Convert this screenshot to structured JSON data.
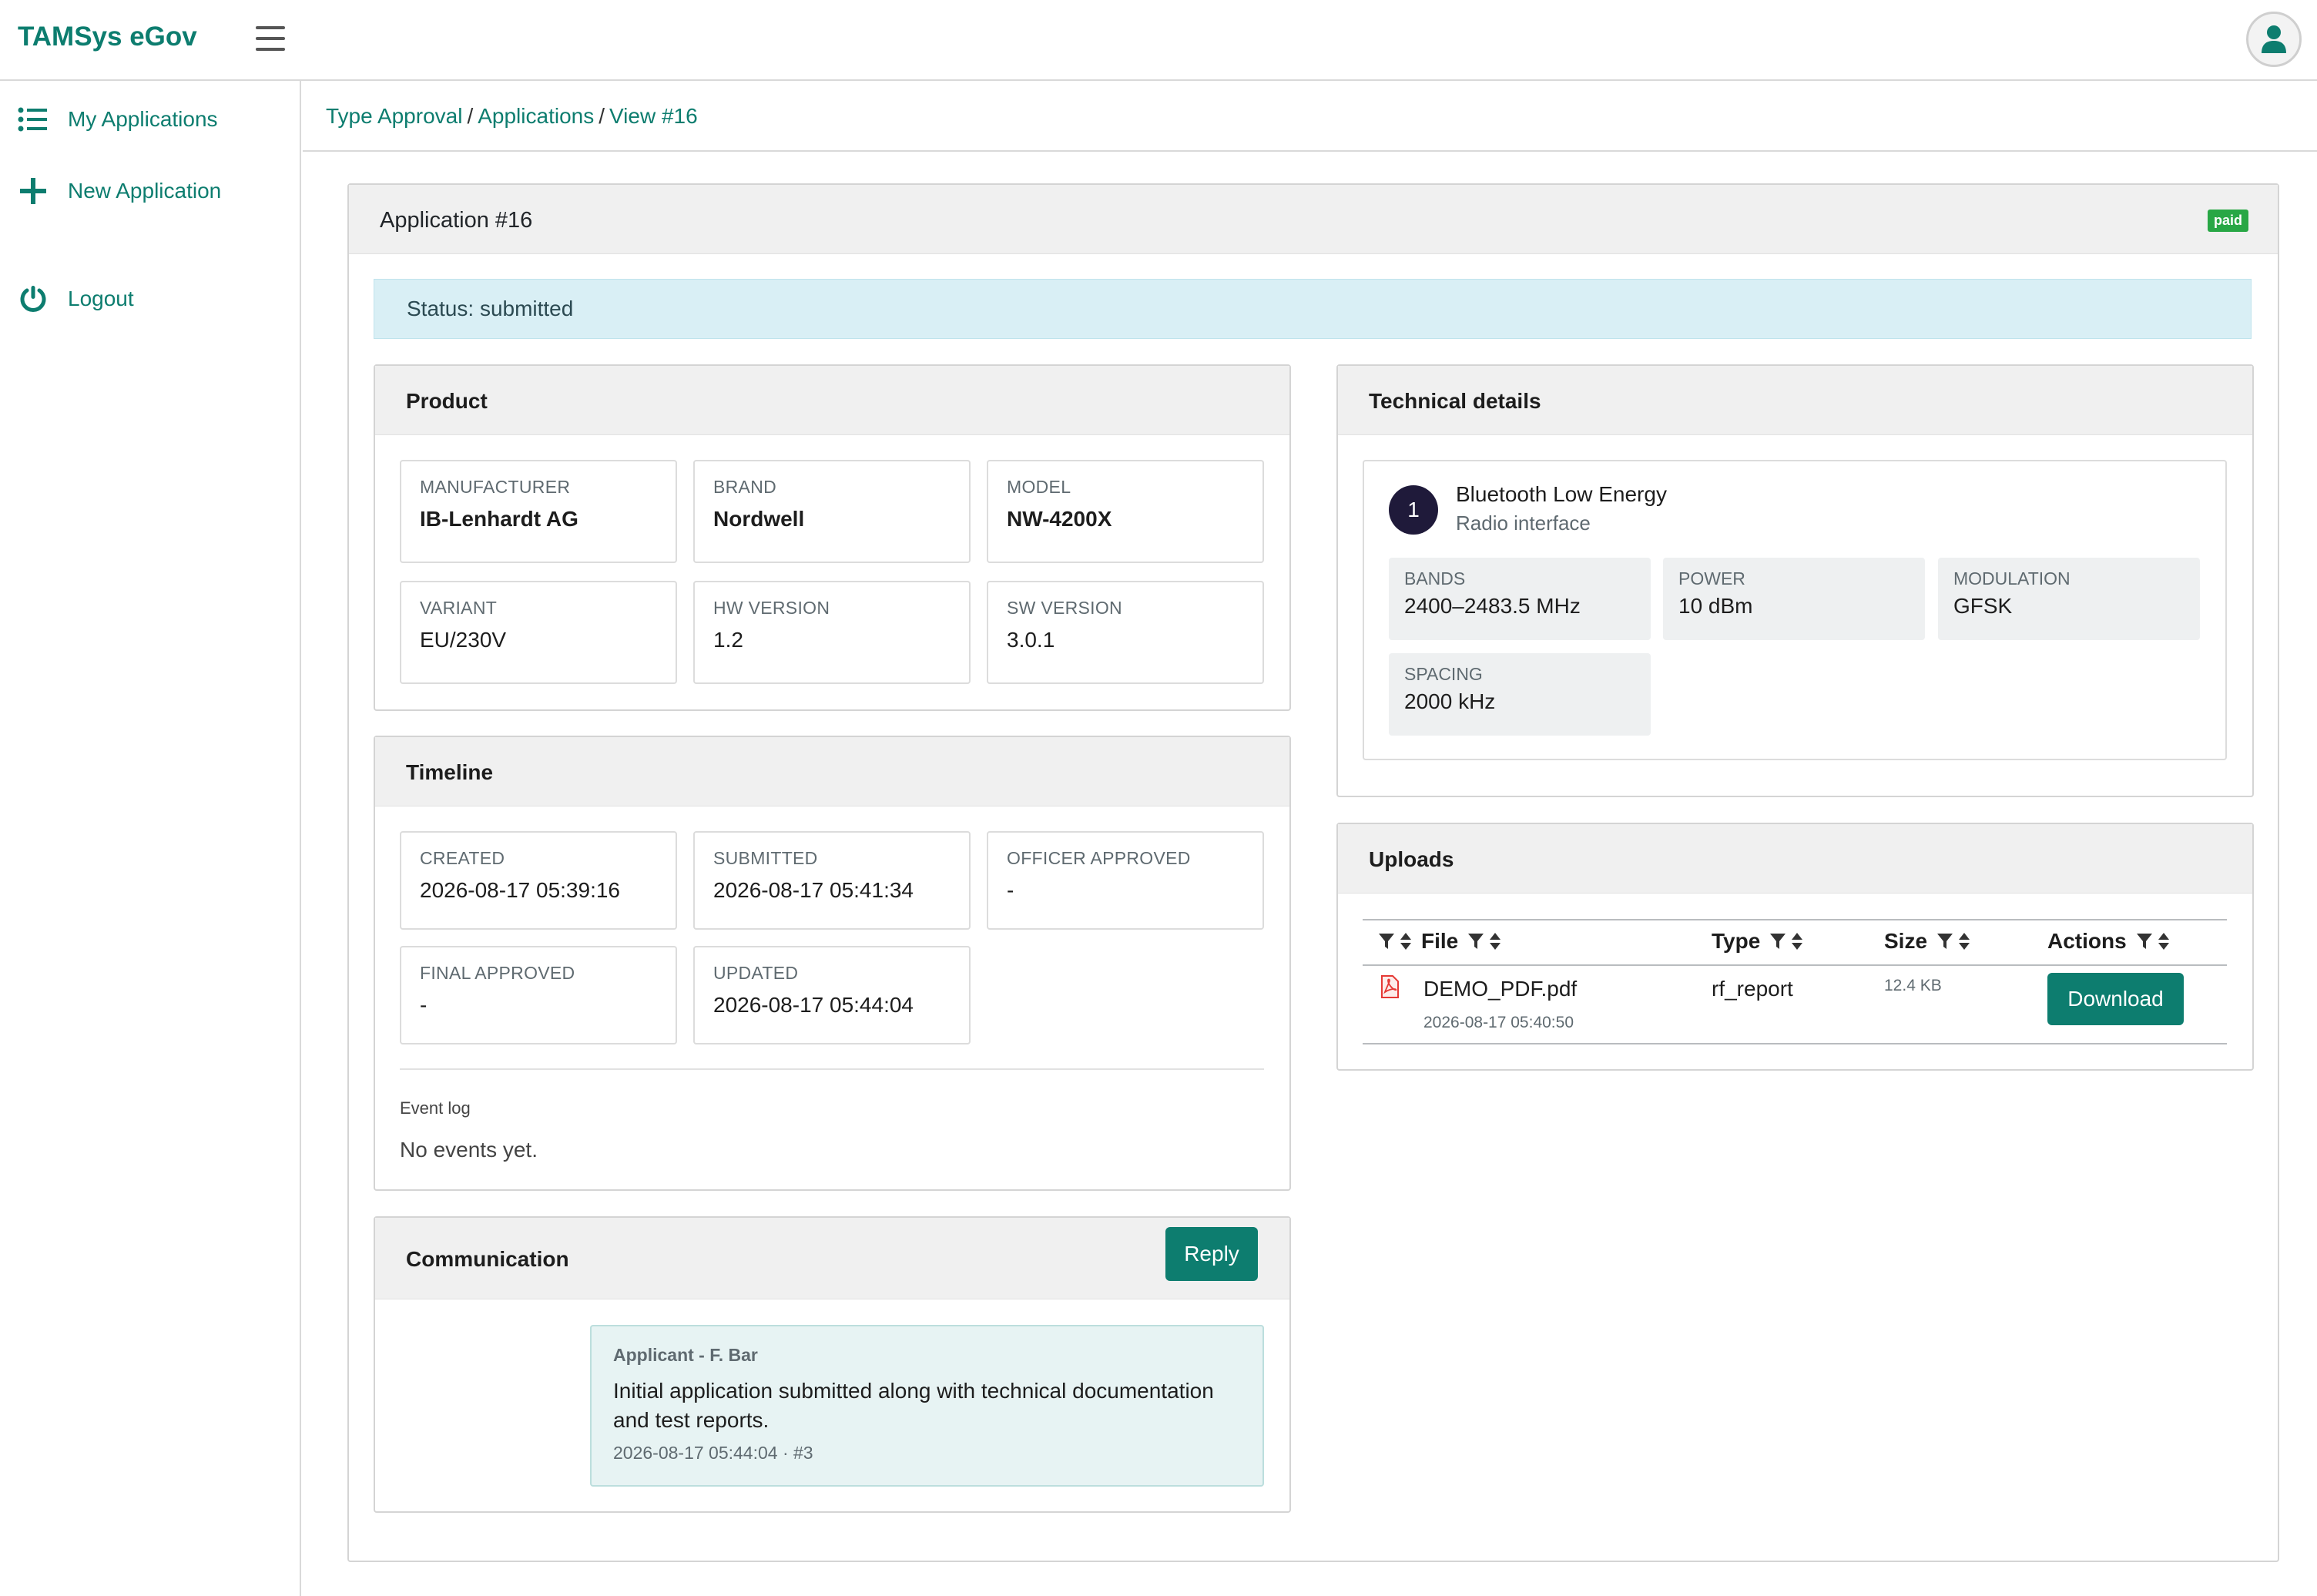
{
  "app": {
    "title": "TAMSys eGov"
  },
  "sidebar": {
    "items": [
      {
        "label": "My Applications",
        "icon": "list-icon"
      },
      {
        "label": "New Application",
        "icon": "plus-icon"
      },
      {
        "label": "Logout",
        "icon": "power-icon"
      }
    ]
  },
  "breadcrumb": {
    "items": [
      "Type Approval",
      "Applications",
      "View #16"
    ]
  },
  "application": {
    "title": "Application #16",
    "badge": "paid",
    "status": "Status: submitted"
  },
  "product": {
    "heading": "Product",
    "fields": [
      {
        "label": "MANUFACTURER",
        "value": "IB-Lenhardt AG"
      },
      {
        "label": "BRAND",
        "value": "Nordwell"
      },
      {
        "label": "MODEL",
        "value": "NW-4200X"
      },
      {
        "label": "VARIANT",
        "value": "EU/230V"
      },
      {
        "label": "HW VERSION",
        "value": "1.2"
      },
      {
        "label": "SW VERSION",
        "value": "3.0.1"
      }
    ]
  },
  "timeline": {
    "heading": "Timeline",
    "fields": [
      {
        "label": "CREATED",
        "value": "2026-08-17 05:39:16"
      },
      {
        "label": "SUBMITTED",
        "value": "2026-08-17 05:41:34"
      },
      {
        "label": "OFFICER APPROVED",
        "value": "-"
      },
      {
        "label": "FINAL APPROVED",
        "value": "-"
      },
      {
        "label": "UPDATED",
        "value": "2026-08-17 05:44:04"
      }
    ],
    "event_log_label": "Event log",
    "event_log_value": "No events yet."
  },
  "communication": {
    "heading": "Communication",
    "reply_label": "Reply",
    "messages": [
      {
        "from": "Applicant - F. Bar",
        "text": "Initial application submitted along with technical documentation and test reports.",
        "meta": "2026-08-17 05:44:04 · #3"
      }
    ]
  },
  "technical": {
    "heading": "Technical details",
    "interfaces": [
      {
        "number": "1",
        "name": "Bluetooth Low Energy",
        "subtitle": "Radio interface",
        "props": [
          {
            "label": "BANDS",
            "value": "2400–2483.5 MHz"
          },
          {
            "label": "POWER",
            "value": "10 dBm"
          },
          {
            "label": "MODULATION",
            "value": "GFSK"
          },
          {
            "label": "SPACING",
            "value": "2000 kHz"
          }
        ]
      }
    ]
  },
  "uploads": {
    "heading": "Uploads",
    "columns": [
      "File",
      "Type",
      "Size",
      "Actions"
    ],
    "rows": [
      {
        "file": "DEMO_PDF.pdf",
        "uploaded": "2026-08-17 05:40:50",
        "type": "rf_report",
        "size": "12.4 KB",
        "action_label": "Download"
      }
    ]
  },
  "colors": {
    "accent": "#0d7d6f",
    "badge": "#28a745",
    "status_bg": "#d9eff5",
    "pdf_icon": "#e53935"
  }
}
